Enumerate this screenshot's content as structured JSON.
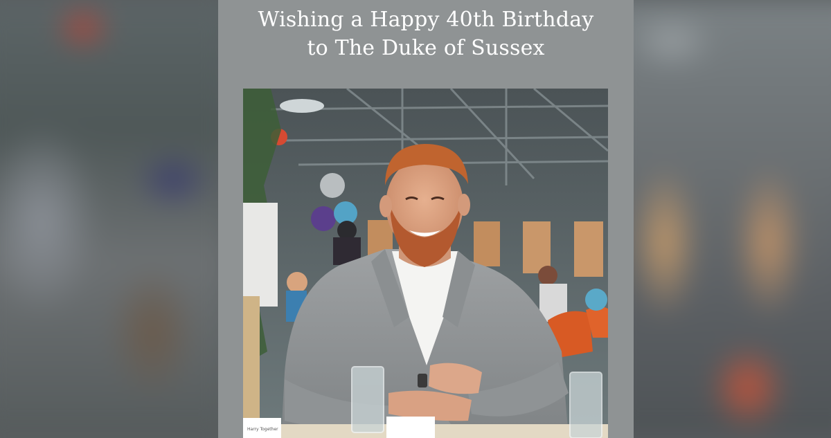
{
  "story": {
    "headline_line1": "Wishing a Happy 40th Birthday",
    "headline_line2": "to The Duke of Sussex"
  },
  "photo": {
    "place_card_text": "Harry Together"
  },
  "colors": {
    "card_background": "#8f9394",
    "headline_text": "#ffffff"
  }
}
